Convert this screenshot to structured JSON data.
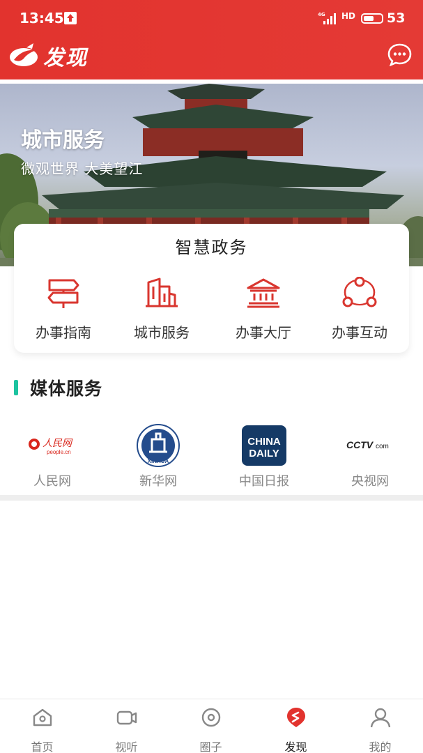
{
  "status_bar": {
    "time": "13:45",
    "network": "4G",
    "hd": "HD",
    "battery": "53"
  },
  "header": {
    "title": "发现",
    "message_icon": "chat-bubble-icon"
  },
  "banner": {
    "title": "城市服务",
    "subtitle": "微观世界  大美望江"
  },
  "smart_gov": {
    "title": "智慧政务",
    "items": [
      {
        "label": "办事指南",
        "icon": "signpost-icon"
      },
      {
        "label": "城市服务",
        "icon": "building-icon"
      },
      {
        "label": "办事大厅",
        "icon": "hall-icon"
      },
      {
        "label": "办事互动",
        "icon": "network-icon"
      }
    ]
  },
  "media_services": {
    "title": "媒体服务",
    "items": [
      {
        "label": "人民网",
        "logo_text": "人民网",
        "logo_sub": "people.cn"
      },
      {
        "label": "新华网",
        "logo_text": "XINHUA"
      },
      {
        "label": "中国日报",
        "logo_text": "CHINA",
        "logo_text2": "DAILY"
      },
      {
        "label": "央视网",
        "logo_text": "CCTV",
        "logo_sub": "com"
      }
    ]
  },
  "tabbar": {
    "items": [
      {
        "label": "首页",
        "icon": "home-icon"
      },
      {
        "label": "视听",
        "icon": "video-icon"
      },
      {
        "label": "圈子",
        "icon": "circle-icon"
      },
      {
        "label": "发现",
        "icon": "discover-icon",
        "active": true
      },
      {
        "label": "我的",
        "icon": "user-icon"
      }
    ]
  },
  "colors": {
    "brand_red": "#e2332e",
    "accent_green": "#1dc3a0"
  }
}
